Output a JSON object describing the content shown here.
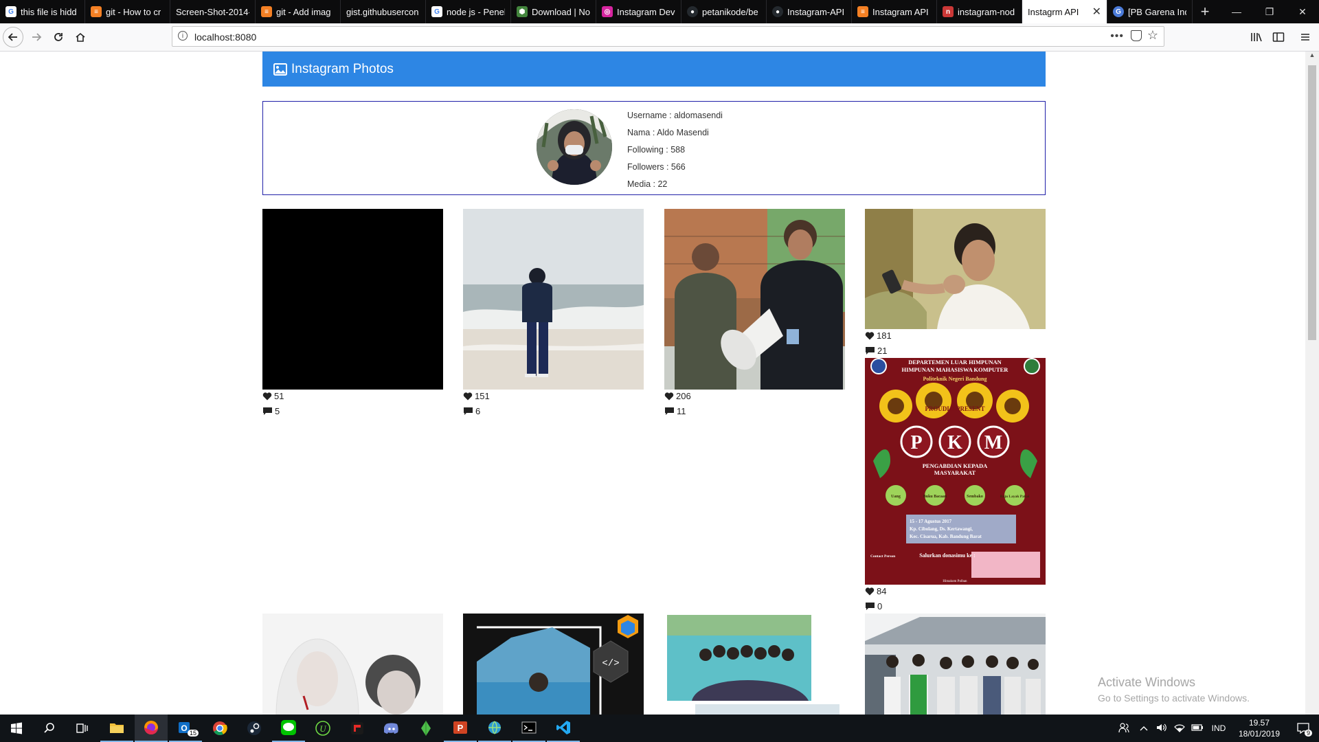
{
  "browser": {
    "tabs": [
      {
        "title": "this file is hidd",
        "icon": "google-icon",
        "color": "#ffffff"
      },
      {
        "title": "git - How to cr",
        "icon": "stackoverflow-icon",
        "color": "#f48024"
      },
      {
        "title": "Screen-Shot-2014-",
        "icon": "blank-icon",
        "color": "#0c0c0d"
      },
      {
        "title": "git - Add imag",
        "icon": "stackoverflow-icon",
        "color": "#f48024"
      },
      {
        "title": "gist.githubusercon",
        "icon": "blank-icon",
        "color": "#0c0c0d"
      },
      {
        "title": "node js - Penel",
        "icon": "google-icon",
        "color": "#ffffff"
      },
      {
        "title": "Download | No",
        "icon": "nodejs-icon",
        "color": "#43853d"
      },
      {
        "title": "Instagram Dev",
        "icon": "instagram-icon",
        "color": "#d6249f"
      },
      {
        "title": "petanikode/be",
        "icon": "github-icon",
        "color": "#24292e"
      },
      {
        "title": "Instagram-API",
        "icon": "github-icon",
        "color": "#24292e"
      },
      {
        "title": "Instagram API",
        "icon": "stackoverflow-icon",
        "color": "#f48024"
      },
      {
        "title": "instagram-nod",
        "icon": "npm-icon",
        "color": "#cb3837"
      },
      {
        "title": "Instagrm API",
        "icon": "blank-icon",
        "color": "#ffffff"
      },
      {
        "title": "[PB Garena Ind",
        "icon": "garena-icon",
        "color": "#4a7ad8"
      }
    ],
    "url": "localhost:8080"
  },
  "page": {
    "header_title": "Instagram Photos",
    "profile": {
      "username_label": "Username : aldomasendi",
      "name_label": "Nama : Aldo Masendi",
      "following_label": "Following : 588",
      "followers_label": "Followers : 566",
      "media_label": "Media : 22"
    },
    "photos": [
      {
        "likes": "51",
        "comments": "5",
        "desc": "black-image"
      },
      {
        "likes": "151",
        "comments": "6",
        "desc": "beach-person"
      },
      {
        "likes": "206",
        "comments": "11",
        "desc": "megaphone-men"
      },
      {
        "likes": "181",
        "comments": "21",
        "desc": "man-phone"
      },
      {
        "likes": "84",
        "comments": "0",
        "desc": "pkm-poster"
      }
    ],
    "poster": {
      "line1": "DEPARTEMEN LUAR HIMPUNAN",
      "line2": "HIMPUNAN MAHASISWA KOMPUTER",
      "line3": "Politeknik Negeri Bandung",
      "proudly": "PROUDLY PRESENT",
      "letters": [
        "P",
        "K",
        "M"
      ],
      "sub1": "PENGABDIAN KEPADA",
      "sub2": "MASYARAKAT",
      "donations": [
        "Uang",
        "Buku Bacaan",
        "Sembako",
        "Baju Layak Pakai"
      ],
      "event1": "15 - 17 Agustus 2017",
      "event2": "Kp. Cibolang, Ds. Kertawangi,",
      "event3": "Kec. Cisarua, Kab. Bandung Barat",
      "salurkan": "Salurkan donasimu ke :",
      "contact": "Contact Person",
      "footer": "Himakom Polban"
    }
  },
  "watermark": {
    "line1": "Activate Windows",
    "line2": "Go to Settings to activate Windows."
  },
  "taskbar": {
    "outlook_badge": "15",
    "lang": "IND",
    "time": "19.57",
    "date": "18/01/2019",
    "notif_count": "9"
  }
}
